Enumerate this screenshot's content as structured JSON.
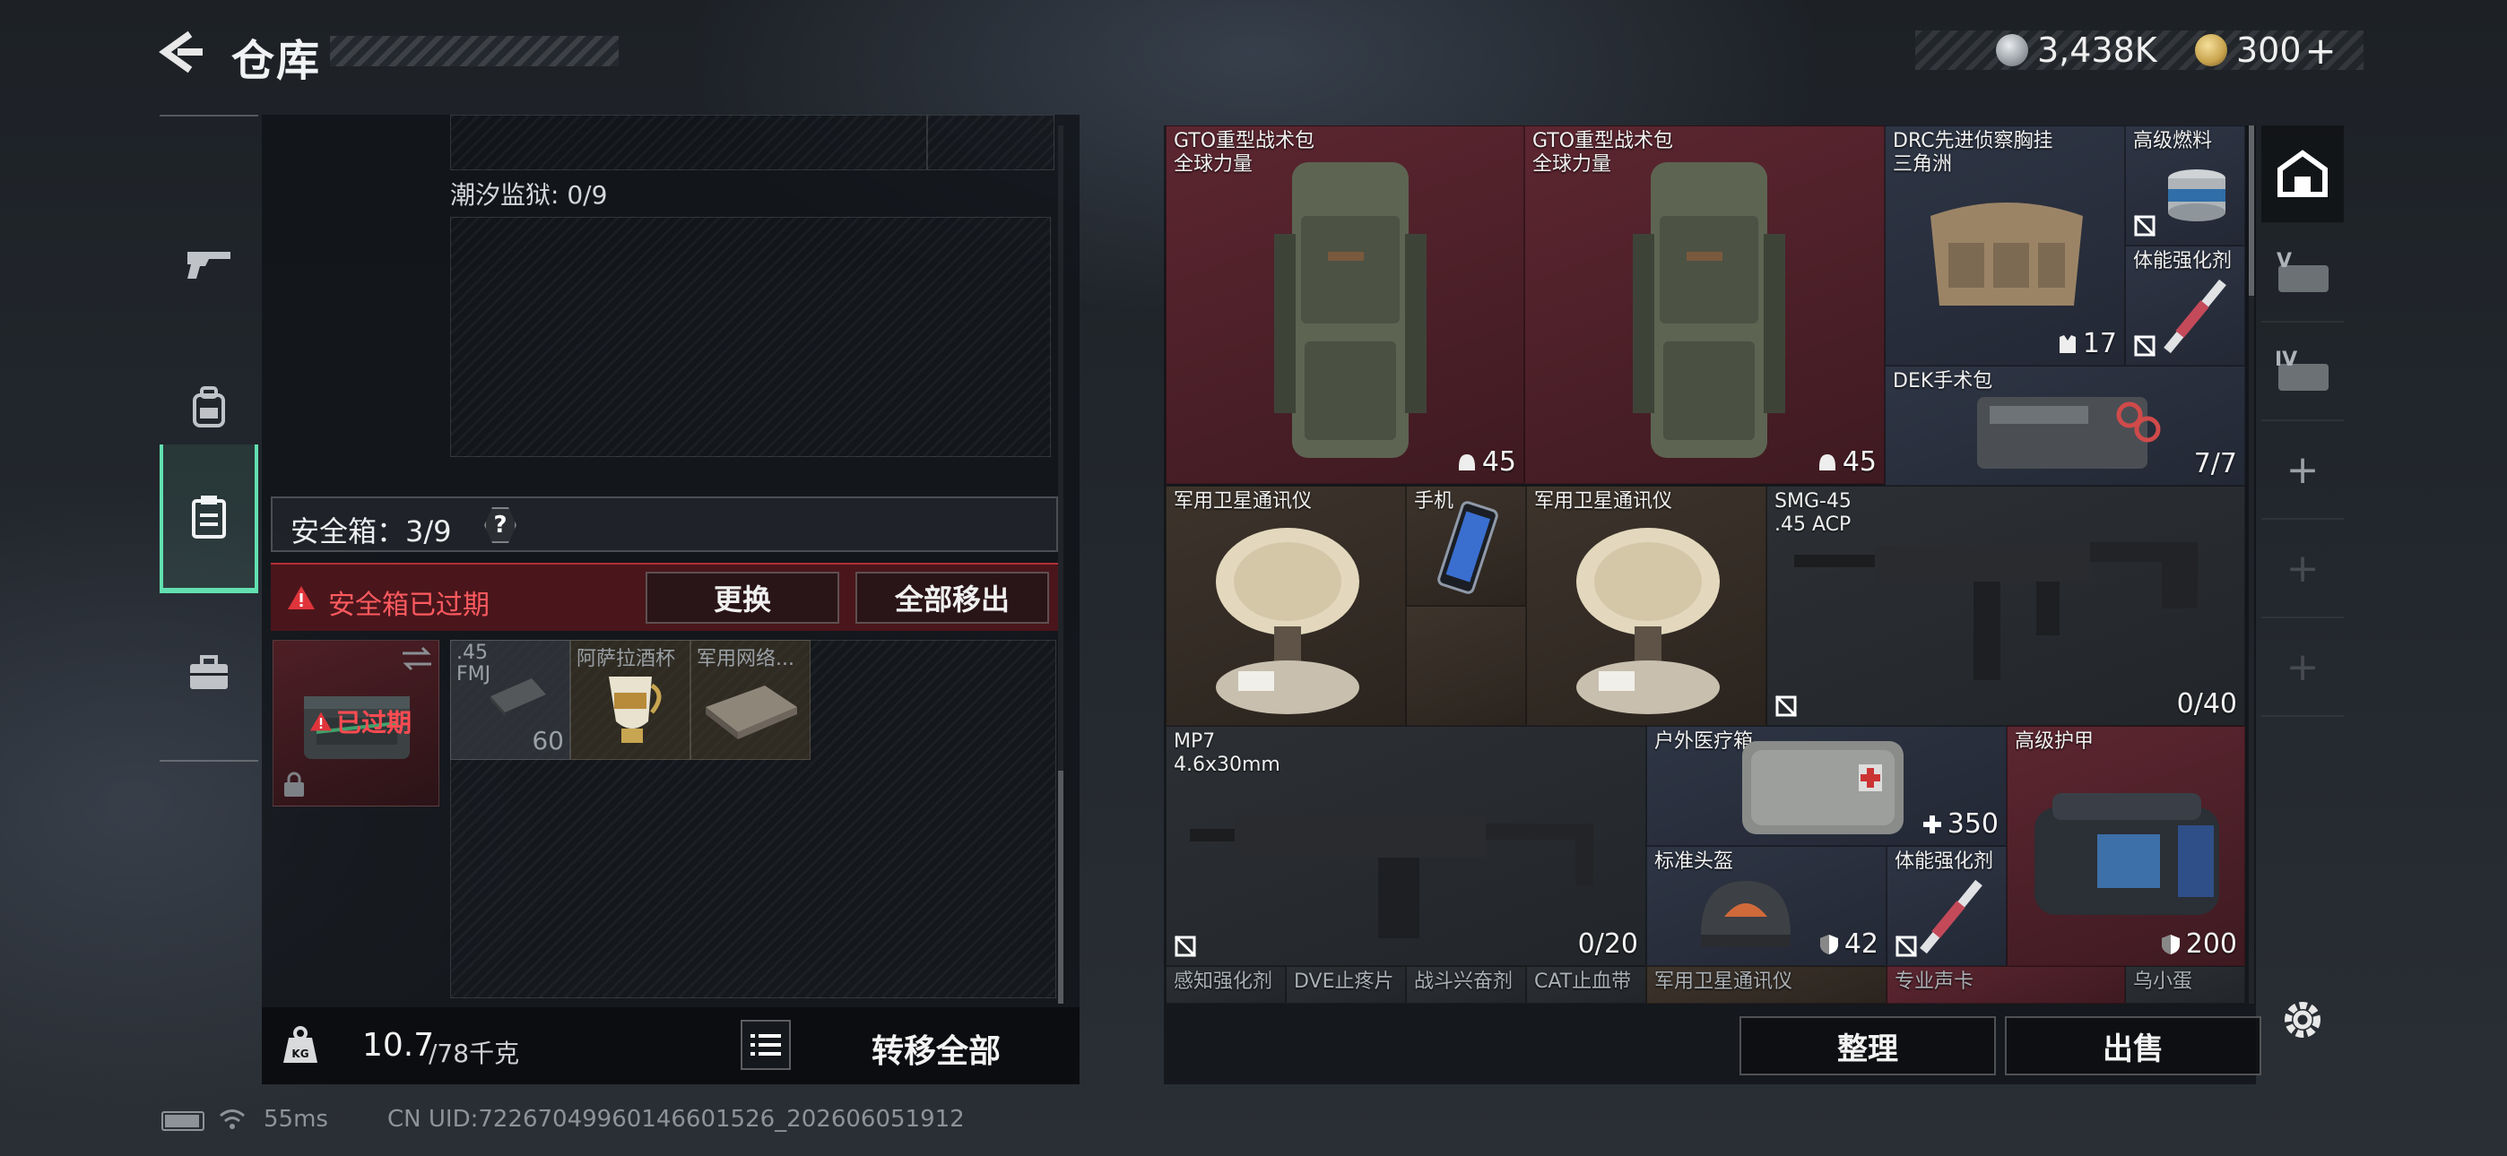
{
  "header": {
    "title": "仓库",
    "currency_1": "3,438K",
    "currency_2": "300",
    "currency_2_plus": "+",
    "back_icon": "back-arrow-icon"
  },
  "nav": {
    "items": [
      {
        "name": "weapon",
        "icon": "pistol-icon"
      },
      {
        "name": "gear",
        "icon": "backpack-icon"
      },
      {
        "name": "container",
        "icon": "clipboard-icon",
        "active": true
      },
      {
        "name": "case",
        "icon": "briefcase-icon"
      }
    ]
  },
  "left": {
    "tide_prison_label": "潮汐监狱: 0/9",
    "safe_box_label": "安全箱：3/9",
    "help": "?",
    "expired_text": "安全箱已过期",
    "replace_button": "更换",
    "remove_all_button": "全部移出",
    "expired_case_label": "已过期",
    "small_items": [
      {
        "name": ".45\nFMJ",
        "value": "60"
      },
      {
        "name": "阿萨拉酒杯",
        "value": ""
      },
      {
        "name": "军用网络...",
        "value": ""
      }
    ],
    "weight_value": "10.7",
    "weight_total": "/78千克",
    "transfer_all_button": "转移全部"
  },
  "stash": {
    "items": [
      {
        "id": "gto1",
        "name": "GTO重型战术包\n全球力量",
        "value": "45",
        "value_icon": "helmet-icon",
        "color": "red"
      },
      {
        "id": "gto2",
        "name": "GTO重型战术包\n全球力量",
        "value": "45",
        "value_icon": "helmet-icon",
        "color": "red"
      },
      {
        "id": "drc",
        "name": "DRC先进侦察胸挂\n三角洲",
        "value": "17",
        "value_icon": "vest-icon",
        "color": "blue"
      },
      {
        "id": "fuel",
        "name": "高级燃料",
        "value": "",
        "color": "blue"
      },
      {
        "id": "stim1",
        "name": "体能强化剂",
        "value": "",
        "color": "blue"
      },
      {
        "id": "dek",
        "name": "DEK手术包",
        "value": "7/7",
        "color": "blue"
      },
      {
        "id": "sat1",
        "name": "军用卫星通讯仪",
        "value": "",
        "color": "brown"
      },
      {
        "id": "phone",
        "name": "手机",
        "value": "",
        "color": "brown"
      },
      {
        "id": "sat2",
        "name": "军用卫星通讯仪",
        "value": "",
        "color": "brown"
      },
      {
        "id": "smg",
        "name": "SMG-45\n.45 ACP",
        "value": "0/40",
        "color": "grey"
      },
      {
        "id": "mp7",
        "name": "MP7\n4.6x30mm",
        "value": "0/20",
        "color": "grey"
      },
      {
        "id": "medkit",
        "name": "户外医疗箱",
        "value": "350",
        "value_icon": "plus-icon",
        "color": "blue"
      },
      {
        "id": "armor",
        "name": "高级护甲",
        "value": "200",
        "value_icon": "shield-icon",
        "color": "red"
      },
      {
        "id": "helmet",
        "name": "标准头盔",
        "value": "42",
        "value_icon": "shield-icon",
        "color": "blue"
      },
      {
        "id": "stim2",
        "name": "体能强化剂",
        "value": "",
        "color": "blue"
      }
    ],
    "bottom_row": [
      "感知强化剂",
      "DVE止疼片",
      "战斗兴奋剂",
      "CAT止血带",
      "军用卫星通讯仪",
      "专业声卡",
      "乌小蛋"
    ]
  },
  "right_buttons": {
    "sort": "整理",
    "sell": "出售"
  },
  "right_tabs": [
    "home-icon",
    "tier-v-case-icon",
    "tier-iv-case-icon",
    "add-icon",
    "add-icon",
    "add-icon"
  ],
  "status": {
    "ping": "55ms",
    "uid": "CN UID:7226704996014660152​6_202606051912"
  },
  "colors": {
    "accent": "#62e0b0",
    "danger": "#d9343b",
    "red_cell": "#5c2630",
    "gold": "#c7a24c"
  }
}
